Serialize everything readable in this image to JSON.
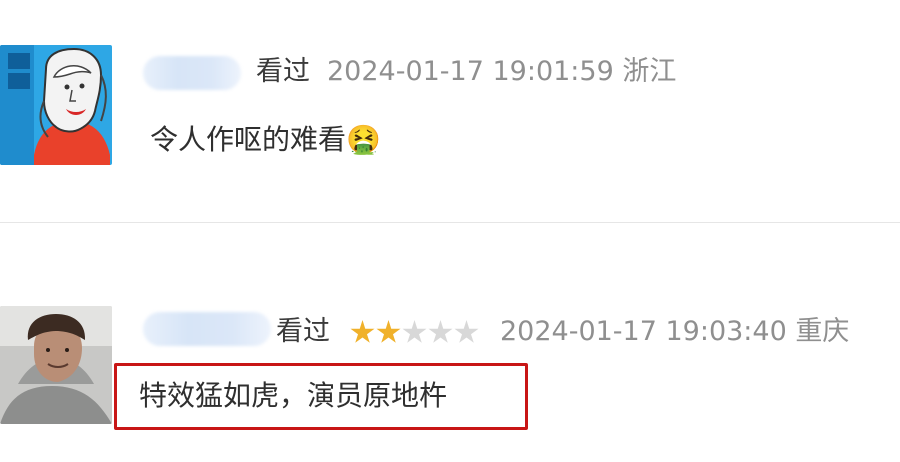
{
  "comments": [
    {
      "watched": "看过",
      "meta": "2024-01-17 19:01:59 浙江",
      "content": "令人作呕的难看🤮"
    },
    {
      "watched": "看过",
      "rating": 2,
      "rating_max": 5,
      "meta": "2024-01-17 19:03:40 重庆",
      "content": "特效猛如虎，演员原地杵"
    }
  ],
  "colors": {
    "highlight_border": "#c81616",
    "star_filled": "#f0b12b",
    "star_empty": "#d8d8d8",
    "meta_text": "#8f8f8f",
    "divider": "#e6e6e6"
  }
}
